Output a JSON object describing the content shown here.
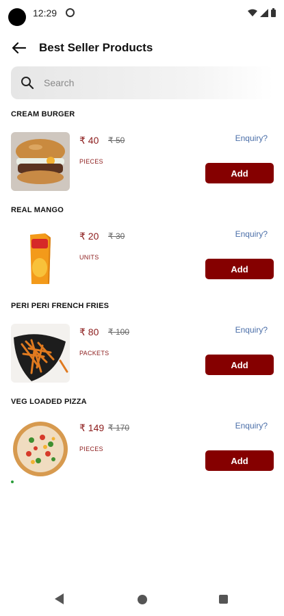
{
  "status_bar": {
    "time": "12:29"
  },
  "header": {
    "title": "Best Seller Products"
  },
  "search": {
    "placeholder": "Search"
  },
  "colors": {
    "accent": "#850000",
    "price": "#8b1a1a",
    "enquiry": "#4a6ea8"
  },
  "products": [
    {
      "name": "CREAM BURGER",
      "price": "₹ 40",
      "mrp": "₹ 50",
      "unit": "PIECES",
      "enquiry_label": "Enquiry?",
      "add_label": "Add",
      "image": "burger-image"
    },
    {
      "name": "REAL MANGO",
      "price": "₹ 20",
      "mrp": "₹ 30",
      "unit": "UNITS",
      "enquiry_label": "Enquiry?",
      "add_label": "Add",
      "image": "mango-juice-image"
    },
    {
      "name": "PERI PERI FRENCH FRIES",
      "price": "₹ 80",
      "mrp": "₹ 100",
      "unit": "PACKETS",
      "enquiry_label": "Enquiry?",
      "add_label": "Add",
      "image": "fries-image"
    },
    {
      "name": "VEG LOADED PIZZA",
      "price": "₹ 149",
      "mrp": "₹ 170",
      "unit": "PIECES",
      "enquiry_label": "Enquiry?",
      "add_label": "Add",
      "image": "pizza-image"
    }
  ]
}
